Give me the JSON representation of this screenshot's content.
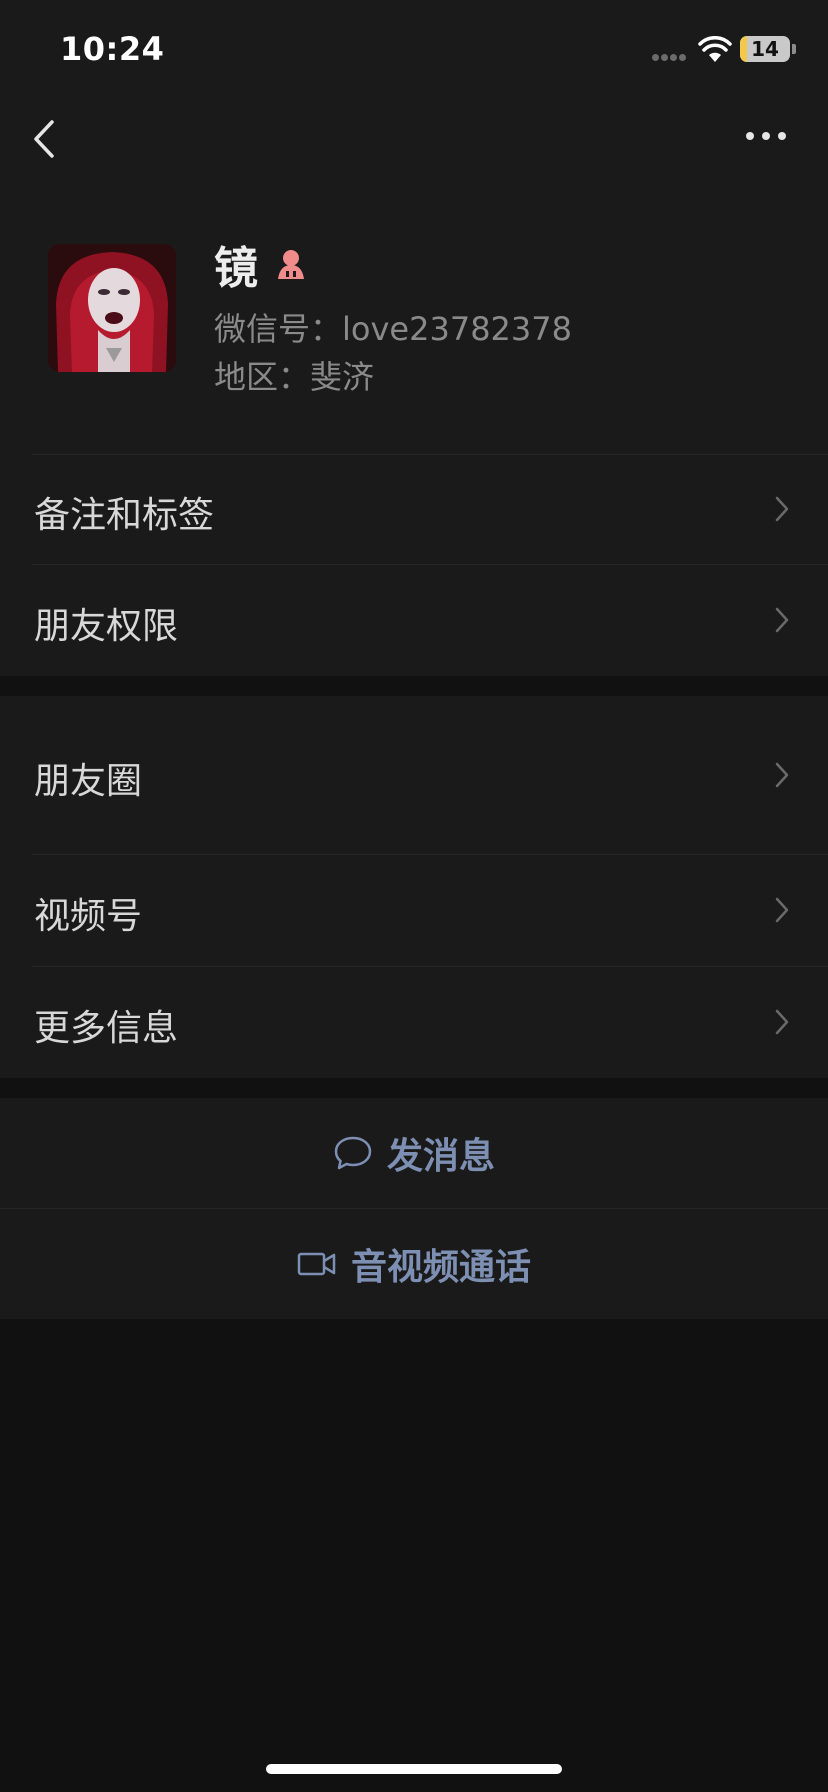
{
  "status_bar": {
    "time": "10:24",
    "battery_level": "14",
    "battery_percent": 14
  },
  "profile": {
    "name": "镜",
    "wechat_id_label": "微信号：",
    "wechat_id": "love23782378",
    "region_label": "地区：",
    "region": "斐济",
    "gender": "female-icon"
  },
  "menu_group_1": [
    {
      "label": "备注和标签"
    },
    {
      "label": "朋友权限"
    }
  ],
  "menu_group_2": [
    {
      "label": "朋友圈"
    },
    {
      "label": "视频号"
    },
    {
      "label": "更多信息"
    }
  ],
  "actions": {
    "send_message": "发消息",
    "av_call": "音视频通话"
  },
  "colors": {
    "background": "#111111",
    "surface": "#1a1a1a",
    "action_text": "#7d90b3",
    "gender_icon": "#f08b8b"
  }
}
